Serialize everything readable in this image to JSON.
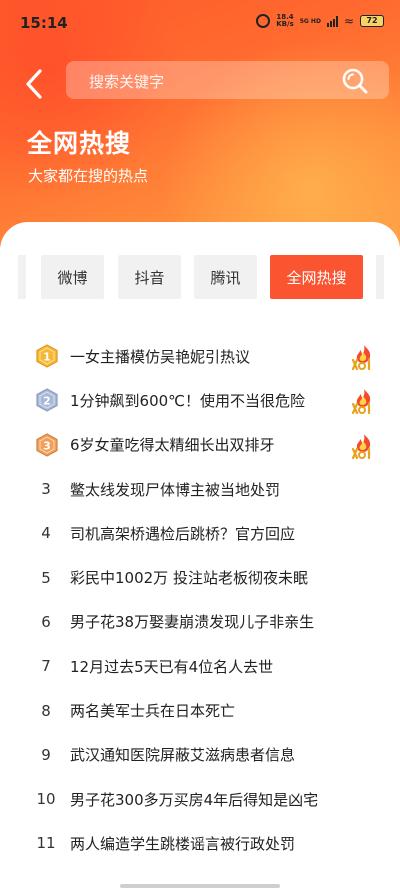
{
  "status_bar": {
    "time": "15:14",
    "net_speed_value": "18.4",
    "net_speed_unit": "KB/s",
    "network": "5G HD",
    "battery": "72"
  },
  "header": {
    "search_placeholder": "搜索关键字",
    "title": "全网热搜",
    "subtitle": "大家都在搜的热点"
  },
  "tabs": [
    {
      "label": "微博",
      "active": false
    },
    {
      "label": "抖音",
      "active": false
    },
    {
      "label": "腾讯",
      "active": false
    },
    {
      "label": "全网热搜",
      "active": true
    }
  ],
  "hot_list": [
    {
      "rank": "1",
      "title": "一女主播模仿吴艳妮引热议",
      "medal": "gold",
      "badge": "hot"
    },
    {
      "rank": "2",
      "title": "1分钟飙到600℃！使用不当很危险",
      "medal": "silver",
      "badge": "hot"
    },
    {
      "rank": "3",
      "title": "6岁女童吃得太精细长出双排牙",
      "medal": "bronze",
      "badge": "hot"
    },
    {
      "rank": "3",
      "title": "鳖太线发现尸体博主被当地处罚"
    },
    {
      "rank": "4",
      "title": "司机高架桥遇检后跳桥？官方回应"
    },
    {
      "rank": "5",
      "title": "彩民中1002万 投注站老板彻夜未眠"
    },
    {
      "rank": "6",
      "title": "男子花38万娶妻崩溃发现儿子非亲生"
    },
    {
      "rank": "7",
      "title": "12月过去5天已有4位名人去世"
    },
    {
      "rank": "8",
      "title": "两名美军士兵在日本死亡"
    },
    {
      "rank": "9",
      "title": "武汉通知医院屏蔽艾滋病患者信息"
    },
    {
      "rank": "10",
      "title": "男子花300多万买房4年后得知是凶宅"
    },
    {
      "rank": "11",
      "title": "两人编造学生跳楼谣言被行政处罚"
    }
  ],
  "colors": {
    "accent": "#fa5530",
    "gold": "#f6b833",
    "silver": "#a9b8d6",
    "bronze": "#f0a05a"
  }
}
